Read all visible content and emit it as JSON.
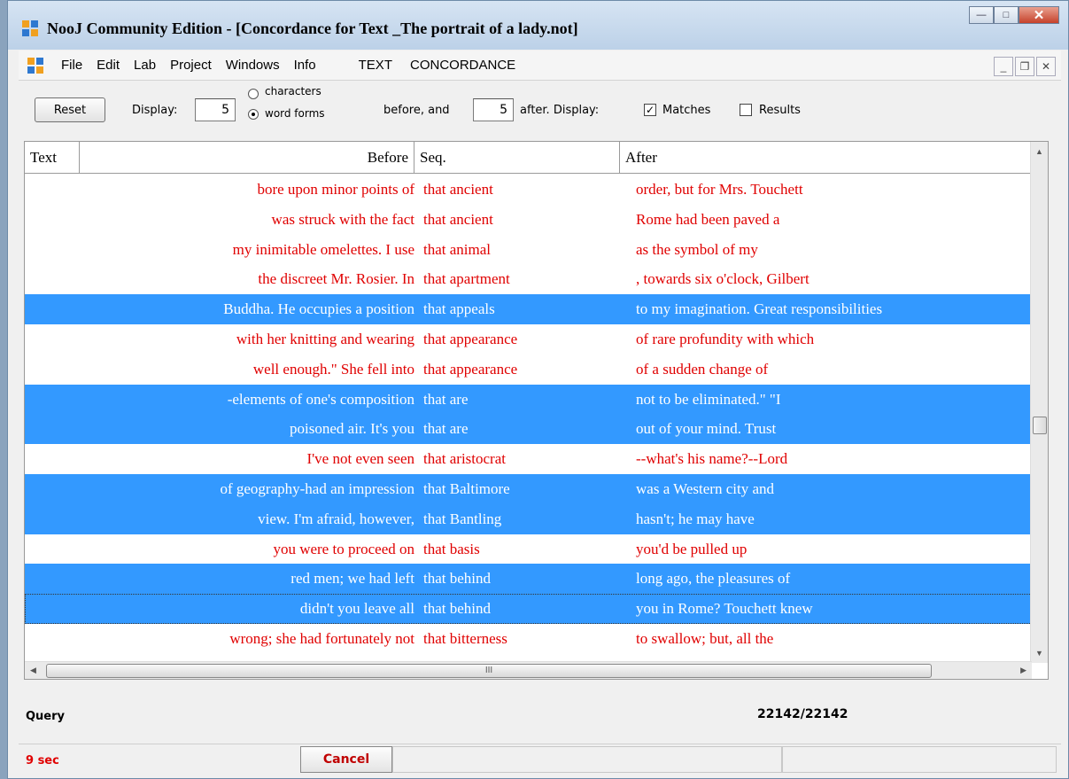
{
  "window": {
    "title": "NooJ Community Edition - [Concordance for Text _The portrait of a lady.not]"
  },
  "menu": {
    "items": [
      "File",
      "Edit",
      "Lab",
      "Project",
      "Windows",
      "Info"
    ],
    "context": [
      "TEXT",
      "CONCORDANCE"
    ]
  },
  "toolbar": {
    "reset_label": "Reset",
    "display_label": "Display:",
    "before_value": "5",
    "radio_characters": "characters",
    "radio_wordforms": "word forms",
    "selected_unit": "word forms",
    "before_and_label": "before, and",
    "after_value": "5",
    "after_display_label": "after. Display:",
    "matches_label": "Matches",
    "matches_checked": true,
    "results_label": "Results",
    "results_checked": false
  },
  "grid": {
    "columns": [
      "Text",
      "Before",
      "Seq.",
      "After"
    ],
    "rows": [
      {
        "before": "bore upon minor points of",
        "seq": "that ancient",
        "after": "order, but for Mrs. Touchett",
        "selected": false
      },
      {
        "before": "was struck with the fact",
        "seq": "that ancient",
        "after": "Rome had been paved a",
        "selected": false
      },
      {
        "before": "my inimitable omelettes. I use",
        "seq": "that animal",
        "after": "as the symbol of my",
        "selected": false
      },
      {
        "before": "the discreet Mr. Rosier. In",
        "seq": "that apartment",
        "after": ", towards six o'clock, Gilbert",
        "selected": false
      },
      {
        "before": "Buddha. He occupies a position",
        "seq": "that appeals",
        "after": "to my imagination. Great responsibilities",
        "selected": true
      },
      {
        "before": "with her knitting and wearing",
        "seq": "that appearance",
        "after": "of rare profundity with which",
        "selected": false
      },
      {
        "before": "well enough.\" She fell into",
        "seq": "that appearance",
        "after": "of a sudden change of",
        "selected": false
      },
      {
        "before": "-elements of one's composition",
        "seq": "that are",
        "after": "not to be eliminated.\"  \"I",
        "selected": true
      },
      {
        "before": "poisoned air. It's you",
        "seq": "that are",
        "after": "out of your mind. Trust",
        "selected": true
      },
      {
        "before": "I've not even seen",
        "seq": "that aristocrat",
        "after": "--what's his name?--Lord",
        "selected": false
      },
      {
        "before": "of geography-had an impression",
        "seq": "that Baltimore",
        "after": "was a Western city and",
        "selected": true
      },
      {
        "before": "view. I'm afraid, however,",
        "seq": "that Bantling",
        "after": "hasn't; he may have",
        "selected": true
      },
      {
        "before": "you were to proceed on",
        "seq": "that basis",
        "after": "you'd be pulled up",
        "selected": false
      },
      {
        "before": "red men; we had left",
        "seq": "that behind",
        "after": "long ago, the pleasures of",
        "selected": true
      },
      {
        "before": "didn't you leave all",
        "seq": "that behind",
        "after": "you in Rome? Touchett knew",
        "selected": true,
        "focused": true
      },
      {
        "before": "wrong; she had fortunately not",
        "seq": "that bitterness",
        "after": "to swallow; but, all the",
        "selected": false
      }
    ],
    "vertical_scroll_position": 0.55,
    "hscroll_thumb_glyph": "III"
  },
  "query": {
    "label": "Query",
    "count": "22142/22142"
  },
  "status": {
    "time": "9 sec",
    "cancel_label": "Cancel"
  },
  "colors": {
    "match_text": "#e00000",
    "selection": "#3399ff"
  },
  "icons": [
    "nooj-app-icon",
    "minimize-icon",
    "maximize-icon",
    "close-icon"
  ]
}
